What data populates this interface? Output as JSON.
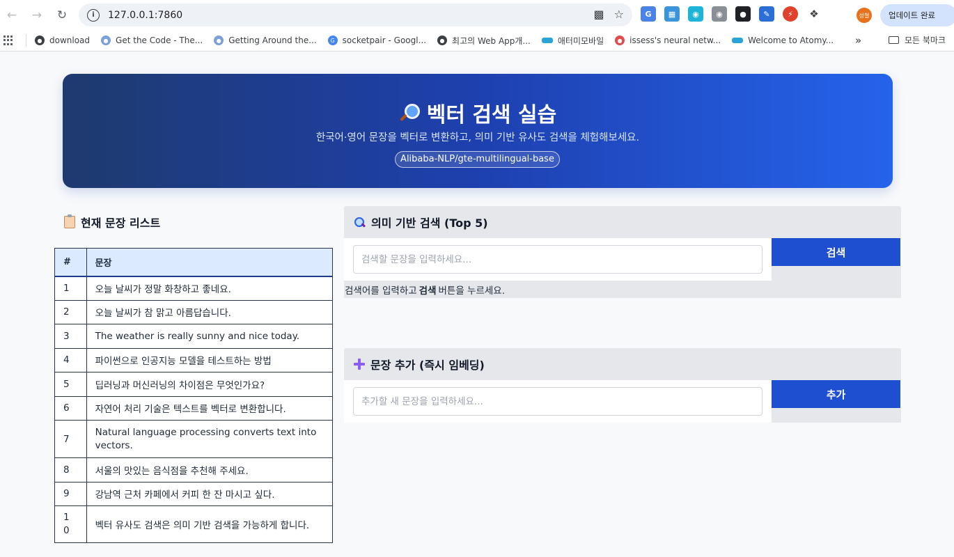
{
  "browser": {
    "url": "127.0.0.1:7860",
    "update_label": "업데이트 완료",
    "avatar_text": "성철",
    "bookmarks": [
      "download",
      "Get the Code - The...",
      "Getting Around the...",
      "socketpair - Googl...",
      "최고의 Web App개...",
      "애터미모바일",
      "issess's neural netw...",
      "Welcome to Atomy..."
    ],
    "all_bookmarks_label": "모든 북마크"
  },
  "hero": {
    "title": "벡터 검색 실습",
    "subtitle": "한국어·영어 문장을 벡터로 변환하고, 의미 기반 유사도 검색을 체험해보세요.",
    "model_badge": "Alibaba-NLP/gte-multilingual-base"
  },
  "sentence_list": {
    "title": "현재 문장 리스트",
    "columns": [
      "#",
      "문장"
    ],
    "rows": [
      {
        "num": "1",
        "text": "오늘 날씨가 정말 화창하고 좋네요."
      },
      {
        "num": "2",
        "text": "오늘 날씨가 참 맑고 아름답습니다."
      },
      {
        "num": "3",
        "text": "The weather is really sunny and nice today."
      },
      {
        "num": "4",
        "text": "파이썬으로 인공지능 모델을 테스트하는 방법"
      },
      {
        "num": "5",
        "text": "딥러닝과 머신러닝의 차이점은 무엇인가요?"
      },
      {
        "num": "6",
        "text": "자연어 처리 기술은 텍스트를 벡터로 변환합니다."
      },
      {
        "num": "7",
        "text": "Natural language processing converts text into vectors."
      },
      {
        "num": "8",
        "text": "서울의 맛있는 음식점을 추천해 주세요."
      },
      {
        "num": "9",
        "text": "강남역 근처 카페에서 커피 한 잔 마시고 싶다."
      },
      {
        "num": "10",
        "text": "벡터 유사도 검색은 의미 기반 검색을 가능하게 합니다."
      }
    ]
  },
  "search": {
    "title": "의미 기반 검색 (Top 5)",
    "placeholder": "검색할 문장을 입력하세요...",
    "value": "",
    "button_label": "검색",
    "hint_before": "검색어를 입력하고",
    "hint_bold": "검색",
    "hint_after": "버튼을 누르세요."
  },
  "add": {
    "title": "문장 추가 (즉시 임베딩)",
    "placeholder": "추가할 새 문장을 입력하세요...",
    "value": "",
    "button_label": "추가"
  },
  "colors": {
    "primary_button": "#1e4fd1",
    "hero_start": "#1e3a6e",
    "hero_end": "#2563eb",
    "table_header": "#dbeafe"
  }
}
